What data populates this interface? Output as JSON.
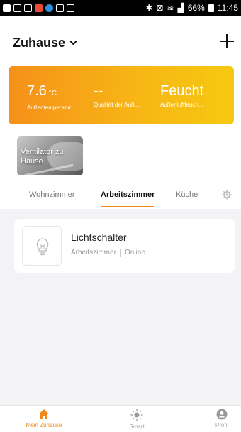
{
  "status_bar": {
    "battery": "66%",
    "time": "11:45"
  },
  "header": {
    "home_name": "Zuhause"
  },
  "weather": {
    "temperature": "7.6",
    "temperature_unit": "°C",
    "temperature_label": "Außentemperatur",
    "quality_value": "--",
    "quality_label": "Qualität der Auß...",
    "humidity_value": "Feucht",
    "humidity_label": "Außenluftfeuch..."
  },
  "scene": {
    "label": "Ventilator zu Hause"
  },
  "tabs": [
    {
      "label": "Wohnzimmer"
    },
    {
      "label": "Arbeitszimmer"
    },
    {
      "label": "Küche"
    }
  ],
  "device": {
    "name": "Lichtschalter",
    "room": "Arbeitszimmer",
    "status": "Online"
  },
  "bottom_nav": [
    {
      "label": "Mein Zuhause"
    },
    {
      "label": "Smart"
    },
    {
      "label": "Profil"
    }
  ],
  "colors": {
    "accent": "#f08a1c",
    "weather_start": "#f5901a",
    "weather_end": "#f6c910"
  }
}
